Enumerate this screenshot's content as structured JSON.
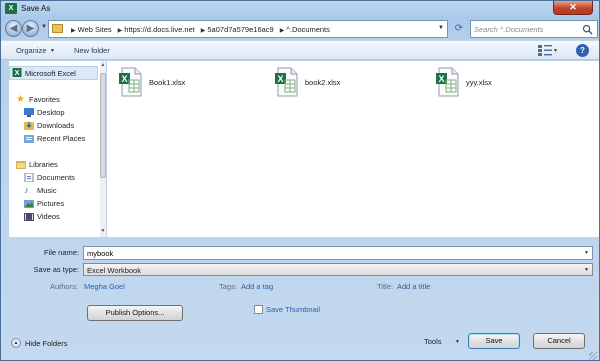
{
  "window": {
    "title": "Save As",
    "app_icon_text": "X",
    "close_glyph": "✕"
  },
  "address": {
    "crumbs": [
      "Web Sites",
      "https://d.docs.live.net",
      "5a07d7a579e16ac9",
      "^.Documents"
    ],
    "search_placeholder": "Search ^.Documents"
  },
  "toolbar": {
    "organize_label": "Organize",
    "new_folder_label": "New folder",
    "help_glyph": "?"
  },
  "sidebar": {
    "top_item": "Microsoft Excel",
    "favorites_header": "Favorites",
    "favorites": [
      "Desktop",
      "Downloads",
      "Recent Places"
    ],
    "libraries_header": "Libraries",
    "libraries": [
      "Documents",
      "Music",
      "Pictures",
      "Videos"
    ]
  },
  "files": [
    {
      "name": "Book1.xlsx"
    },
    {
      "name": "book2.xlsx"
    },
    {
      "name": "yyy.xlsx"
    }
  ],
  "form": {
    "file_name_label": "File name:",
    "file_name_value": "mybook",
    "save_as_type_label": "Save as type:",
    "save_as_type_value": "Excel Workbook",
    "authors_label": "Authors:",
    "authors_value": "Megha Goel",
    "tags_label": "Tags:",
    "tags_value": "Add a tag",
    "title_label": "Title:",
    "title_value": "Add a title",
    "publish_options_label": "Publish Options...",
    "save_thumbnail_label": "Save Thumbnail",
    "save_thumbnail_checked": false
  },
  "footer": {
    "hide_folders_label": "Hide Folders",
    "tools_label": "Tools",
    "save_label": "Save",
    "cancel_label": "Cancel"
  },
  "colors": {
    "excel_green": "#1e7145",
    "link_blue": "#2a5fa8",
    "frame_blue": "#bcd6f0"
  }
}
